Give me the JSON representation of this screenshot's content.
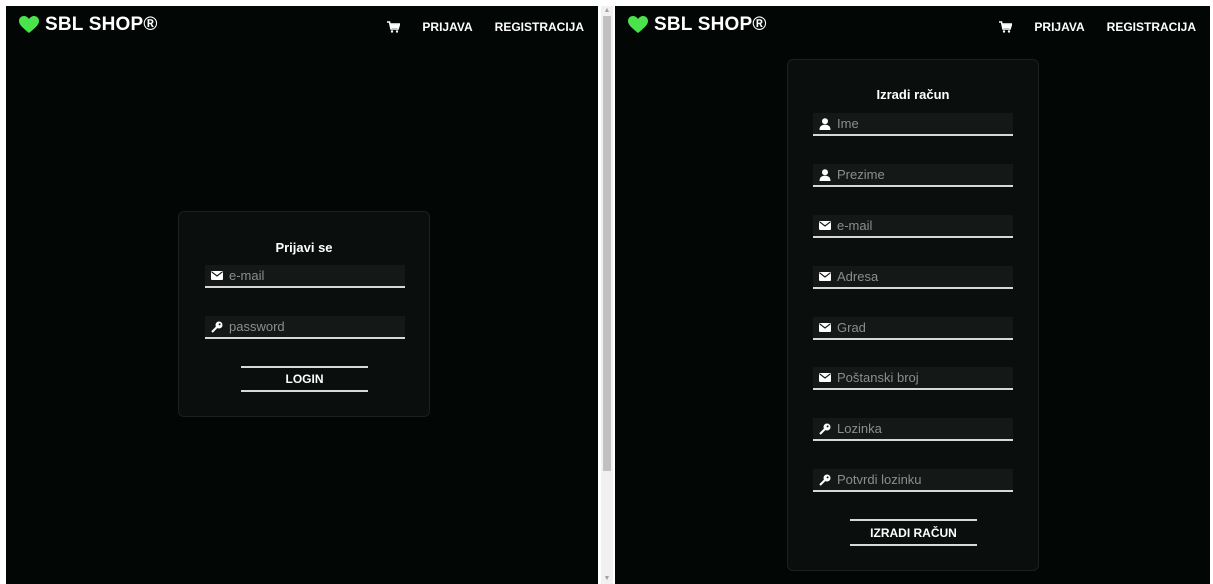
{
  "brand": {
    "name": "SBL SHOP®",
    "color": "#4be34b"
  },
  "nav": {
    "login": "PRIJAVA",
    "register": "REGISTRACIJA"
  },
  "login_form": {
    "title": "Prijavi se",
    "email_placeholder": "e-mail",
    "password_placeholder": "password",
    "submit_label": "LOGIN"
  },
  "register_form": {
    "title": "Izradi račun",
    "fields": [
      {
        "icon": "user-icon",
        "placeholder": "Ime"
      },
      {
        "icon": "user-icon",
        "placeholder": "Prezime"
      },
      {
        "icon": "envelope-icon",
        "placeholder": "e-mail"
      },
      {
        "icon": "envelope-icon",
        "placeholder": "Adresa"
      },
      {
        "icon": "envelope-icon",
        "placeholder": "Grad"
      },
      {
        "icon": "envelope-icon",
        "placeholder": "Poštanski broj"
      },
      {
        "icon": "key-icon",
        "placeholder": "Lozinka"
      },
      {
        "icon": "key-icon",
        "placeholder": "Potvrdi lozinku"
      }
    ],
    "submit_label": "IZRADI RAČUN"
  },
  "colors": {
    "background": "#020604",
    "card": "#0a0e0c",
    "text": "#ffffff",
    "placeholder": "#8a8f8c"
  }
}
